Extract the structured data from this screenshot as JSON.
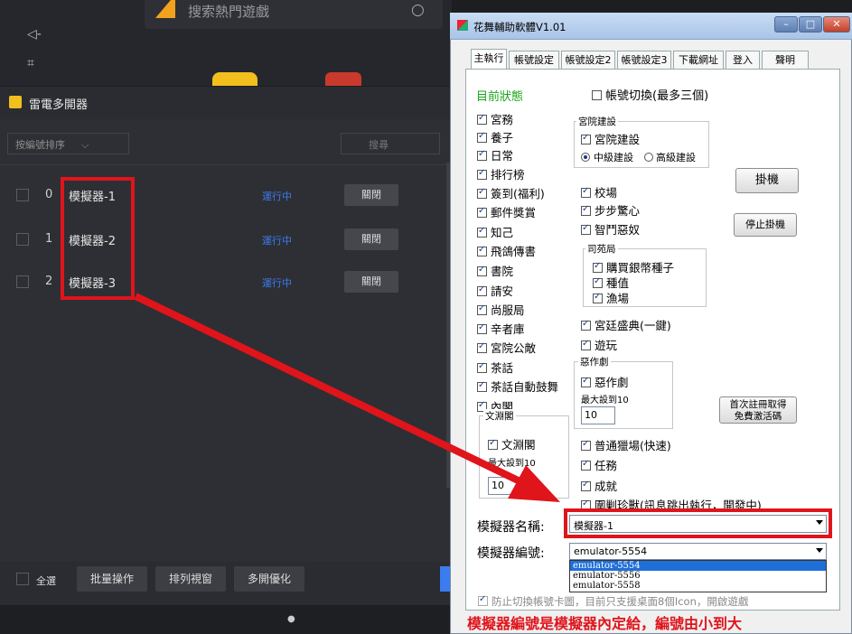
{
  "left_app": {
    "top_search_placeholder": "搜索熱門遊戲",
    "multi_header": {
      "title": "雷電多開器"
    },
    "sort_select": "按編號排序",
    "search_button": "搜尋",
    "emulators": [
      {
        "index": "0",
        "name": "模擬器-1",
        "status": "運行中",
        "close": "關閉"
      },
      {
        "index": "1",
        "name": "模擬器-2",
        "status": "運行中",
        "close": "關閉"
      },
      {
        "index": "2",
        "name": "模擬器-3",
        "status": "運行中",
        "close": "關閉"
      }
    ],
    "footer": {
      "select_all": "全選",
      "batch_ops": "批量操作",
      "arrange": "排列視窗",
      "optimize": "多開優化"
    }
  },
  "helper_window": {
    "title": "花舞輔助軟體V1.01",
    "tabs": [
      "主執行",
      "帳號設定",
      "帳號設定2",
      "帳號設定3",
      "下載網址",
      "登入",
      "聲明"
    ],
    "status_label": "目前狀態",
    "account_switch": "帳號切換(最多三個)",
    "left_tasks": [
      "宮務",
      "養子",
      "日常",
      "排行榜",
      "簽到(福利)",
      "郵件獎賞",
      "知己",
      "飛鴿傳書",
      "書院",
      "請安",
      "尚服局",
      "辛者庫",
      "宮院公敵",
      "茶話",
      "茶話自動鼓舞",
      "內閣"
    ],
    "palace_group": {
      "label": "宮院建設",
      "check": "宮院建設",
      "radio_mid": "中級建設",
      "radio_high": "高級建設"
    },
    "mid_tasks_a": [
      "校場",
      "步步驚心",
      "智鬥惡奴"
    ],
    "garden_group": {
      "label": "司苑局",
      "items": [
        "購買銀幣種子",
        "種值",
        "漁場"
      ]
    },
    "mid_tasks_b": [
      "宮廷盛典(一鍵)",
      "遊玩"
    ],
    "prank_group": {
      "label": "惡作劇",
      "check": "惡作劇",
      "max_label": "最大設到10",
      "value": "10"
    },
    "wenyuan_group": {
      "label": "文淵閣",
      "check": "文淵閣",
      "max_label": "最大設到10",
      "value": "10"
    },
    "mid_tasks_c": [
      "普通獵場(快速)",
      "任務",
      "成就",
      "圍剿珍獸(訊息跳出執行，開發中)"
    ],
    "buttons": {
      "hangup": "掛機",
      "stop": "停止掛機",
      "register": "首次註冊取得\n免費激活碼"
    },
    "emulator_name_label": "模擬器名稱:",
    "emulator_name_value": "模擬器-1",
    "emulator_id_label": "模擬器編號:",
    "emulator_id_value": "emulator-5554",
    "emulator_id_options": [
      "emulator-5554",
      "emulator-5556",
      "emulator-5558"
    ],
    "prevent_switch": "防止切換帳號卡圖，目前只支援桌面8個Icon，開啟遊戲",
    "annotation": "模擬器編號是模擬器內定給，編號由小到大"
  },
  "colors": {
    "highlight_red": "#e0141b",
    "running_blue": "#3b7cf0",
    "status_green": "#1aa51a"
  }
}
